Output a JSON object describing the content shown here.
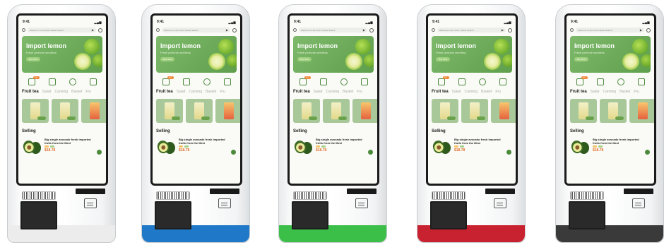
{
  "kiosks": [
    {
      "accent": "#ececec"
    },
    {
      "accent": "#1f78c8"
    },
    {
      "accent": "#3bbf48"
    },
    {
      "accent": "#c8212f"
    },
    {
      "accent": "#3a3a3a"
    }
  ],
  "app": {
    "time": "9:41",
    "search_placeholder": "Welcome to the fresh market Search",
    "banner": {
      "title": "Import lemon",
      "subtitle": "Fresh perfume seedless",
      "button": "Buy Now"
    },
    "hot_badge": "HOT",
    "tabs": [
      "Fruit tea",
      "Salad",
      "Canning",
      "Basket",
      "Fru"
    ],
    "section_title": "Selling",
    "product": {
      "name": "Big single avocado fresh imported fruits from the Mexi",
      "price": "$18.78"
    }
  }
}
